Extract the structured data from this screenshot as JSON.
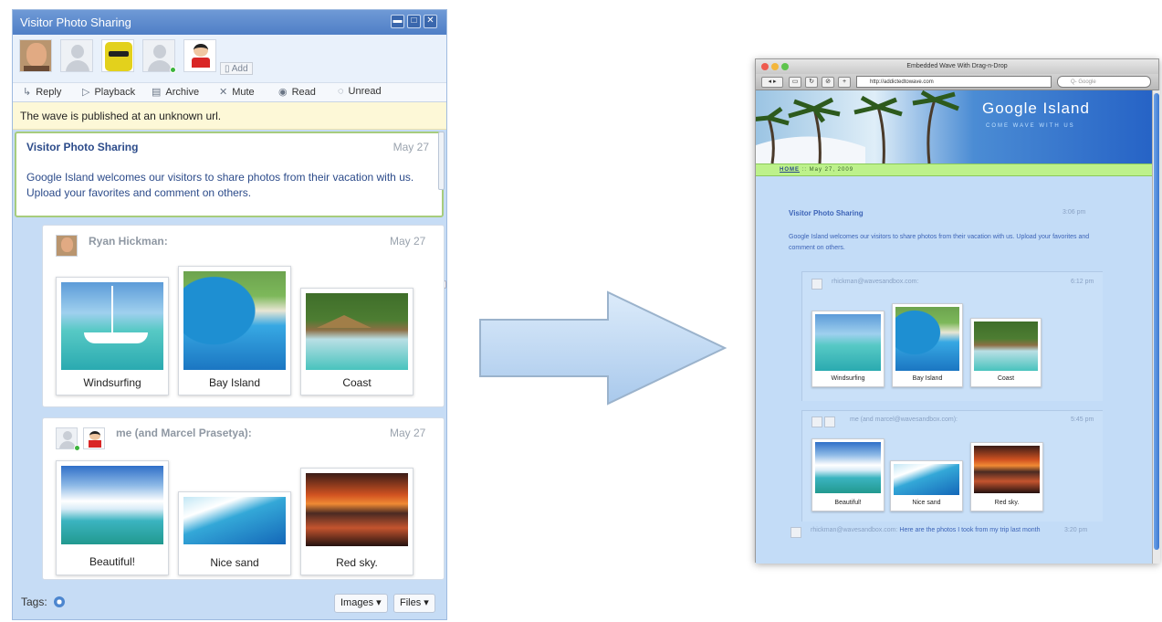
{
  "wave_panel": {
    "title": "Visitor Photo Sharing",
    "window_controls": [
      "minimize",
      "maximize",
      "close"
    ],
    "add_label": "Add",
    "toolbar": [
      {
        "label": "Reply",
        "icon": "reply-icon"
      },
      {
        "label": "Playback",
        "icon": "playback-icon"
      },
      {
        "label": "Archive",
        "icon": "archive-icon"
      },
      {
        "label": "Mute",
        "icon": "mute-icon"
      },
      {
        "label": "Read",
        "icon": "read-icon"
      },
      {
        "label": "Unread",
        "icon": "unread-icon"
      }
    ],
    "notice": "The wave is published at an unknown url.",
    "root_blip": {
      "title": "Visitor Photo Sharing",
      "date": "May 27",
      "body": "Google Island welcomes our visitors to share photos from their vacation with us. Upload your favorites and comment on others."
    },
    "replies": [
      {
        "author": "Ryan Hickman:",
        "date": "May 27",
        "photos": [
          "Windsurfing",
          "Bay Island",
          "Coast"
        ]
      },
      {
        "author": "me (and Marcel Prasetya):",
        "date": "May 27",
        "photos": [
          "Beautiful!",
          "Nice sand",
          "Red sky."
        ]
      }
    ],
    "footer": {
      "tags_label": "Tags:",
      "images_button": "Images ▾",
      "files_button": "Files ▾"
    }
  },
  "browser": {
    "window_title": "Embedded Wave With Drag-n-Drop",
    "url": "http://addictedtowave.com",
    "search_placeholder": "Q- Google",
    "site_title": "Google Island",
    "site_subtitle": "COME WAVE WITH US",
    "nav_home": "HOME",
    "nav_date": ":: May 27, 2009",
    "root_blip": {
      "title": "Visitor Photo Sharing",
      "time": "3:06 pm",
      "body": "Google Island welcomes our visitors to share photos from their vacation with us. Upload your favorites and comment on others."
    },
    "replies": [
      {
        "author": "rhickman@wavesandbox.com:",
        "time": "6:12 pm",
        "photos": [
          "Windsurfing",
          "Bay Island",
          "Coast"
        ]
      },
      {
        "author": "me (and marcel@wavesandbox.com):",
        "time": "5:45 pm",
        "photos": [
          "Beautiful!",
          "Nice sand",
          "Red sky."
        ]
      }
    ],
    "last_reply": {
      "author": "rhickman@wavesandbox.com:",
      "text": "Here are the photos I took from my trip last month",
      "time": "3:20 pm"
    }
  },
  "colors": {
    "wave_background": "#c6dcf5",
    "title_bar": "#5a88cc",
    "root_blip_border": "#a7cc7d",
    "notice_background": "#fdf8d7",
    "arrow_fill": "#bcd7f1",
    "site_nav": "#bdf18b"
  }
}
